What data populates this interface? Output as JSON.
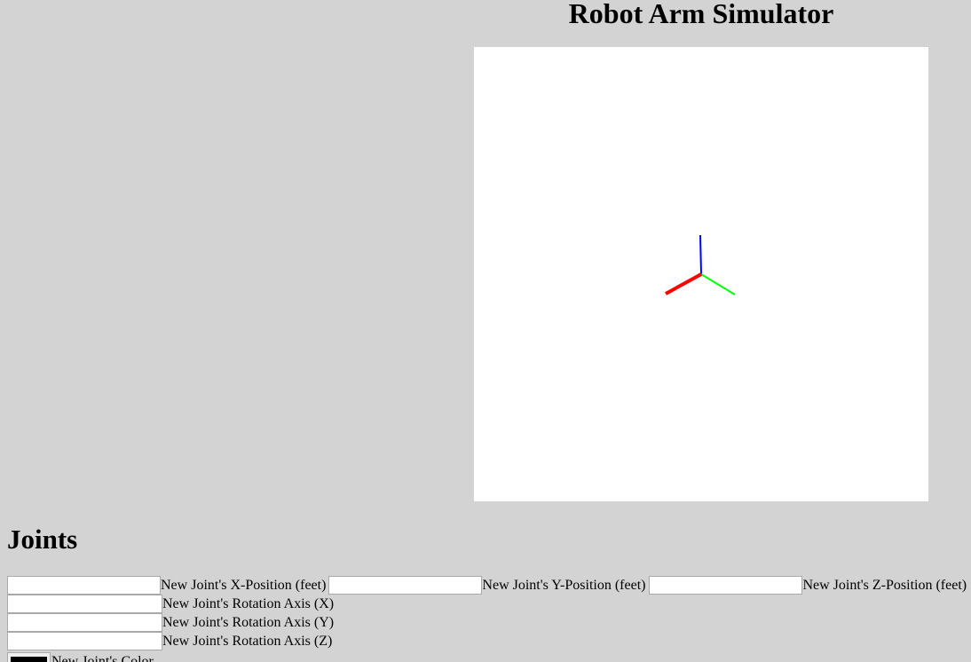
{
  "header": {
    "title": "Robot Arm Simulator"
  },
  "viewport": {
    "background": "#ffffff",
    "axes": {
      "x_color": "#ff0000",
      "y_color": "#00ff00",
      "z_color": "#0000ff"
    }
  },
  "joints": {
    "heading": "Joints",
    "x_position": {
      "label": "New Joint's X-Position (feet)",
      "value": ""
    },
    "y_position": {
      "label": "New Joint's Y-Position (feet)",
      "value": ""
    },
    "z_position": {
      "label": "New Joint's Z-Position (feet)",
      "value": ""
    },
    "rotation_x": {
      "label": "New Joint's Rotation Axis (X)",
      "value": ""
    },
    "rotation_y": {
      "label": "New Joint's Rotation Axis (Y)",
      "value": ""
    },
    "rotation_z": {
      "label": "New Joint's Rotation Axis (Z)",
      "value": ""
    },
    "color": {
      "label": "New Joint's Color",
      "value": "#000000"
    }
  }
}
